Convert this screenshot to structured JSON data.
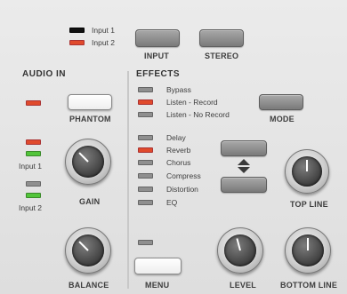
{
  "legend": {
    "input1": "Input 1",
    "input2": "Input 2"
  },
  "top_buttons": {
    "input": "INPUT",
    "stereo": "STEREO"
  },
  "audio_in": {
    "heading": "AUDIO IN",
    "phantom": "PHANTOM",
    "input1": "Input 1",
    "input2": "Input 2",
    "gain": "GAIN",
    "balance": "BALANCE"
  },
  "effects": {
    "heading": "EFFECTS",
    "modes": [
      "Bypass",
      "Listen - Record",
      "Listen - No Record"
    ],
    "mode_button": "MODE",
    "list": [
      "Delay",
      "Reverb",
      "Chorus",
      "Compress",
      "Distortion",
      "EQ"
    ],
    "top_line": "TOP LINE",
    "bottom_line": "BOTTOM LINE",
    "menu": "MENU",
    "level": "LEVEL"
  },
  "colors": {
    "red": "#e04a2c",
    "green": "#52c43a",
    "gray": "#8f8f8f"
  }
}
